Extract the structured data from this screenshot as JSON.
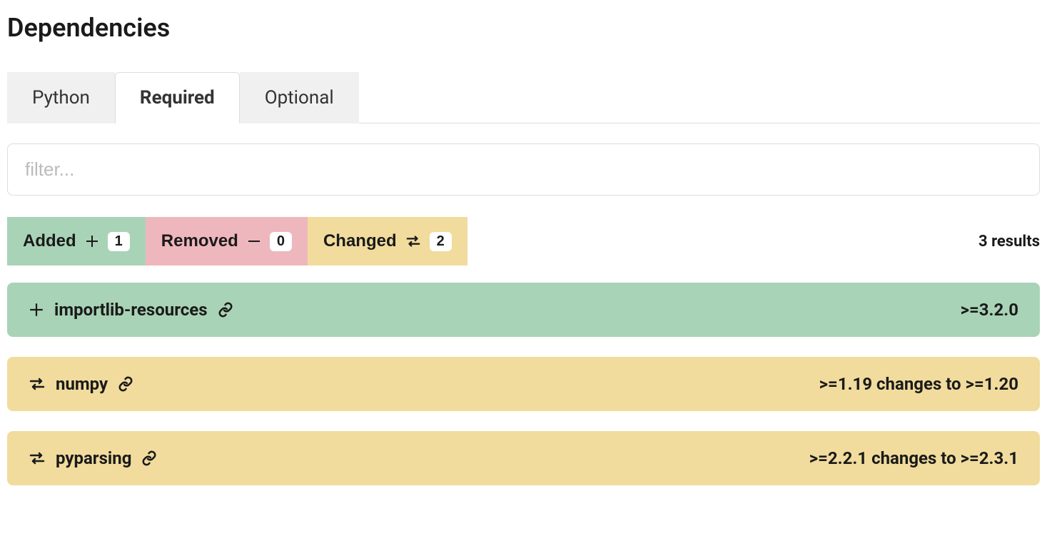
{
  "title": "Dependencies",
  "tabs": [
    {
      "label": "Python",
      "active": false
    },
    {
      "label": "Required",
      "active": true
    },
    {
      "label": "Optional",
      "active": false
    }
  ],
  "filter": {
    "placeholder": "filter...",
    "value": ""
  },
  "badges": {
    "added": {
      "label": "Added",
      "count": 1
    },
    "removed": {
      "label": "Removed",
      "count": 0
    },
    "changed": {
      "label": "Changed",
      "count": 2
    }
  },
  "results_label": "3 results",
  "dependencies": [
    {
      "kind": "added",
      "name": "importlib-resources",
      "version": ">=3.2.0"
    },
    {
      "kind": "changed",
      "name": "numpy",
      "version": ">=1.19 changes to >=1.20"
    },
    {
      "kind": "changed",
      "name": "pyparsing",
      "version": ">=2.2.1 changes to >=2.3.1"
    }
  ]
}
